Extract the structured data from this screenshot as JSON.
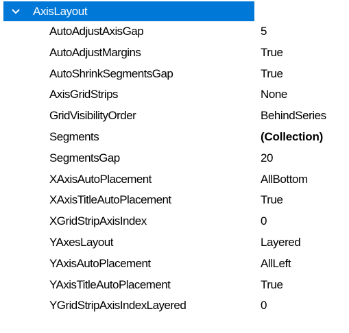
{
  "category": {
    "label": "AxisLayout",
    "expanded": true,
    "icon": "chevron-down-icon",
    "accent": "#0078d7"
  },
  "properties": [
    {
      "name": "AutoAdjustAxisGap",
      "value": "5"
    },
    {
      "name": "AutoAdjustMargins",
      "value": "True"
    },
    {
      "name": "AutoShrinkSegmentsGap",
      "value": "True"
    },
    {
      "name": "AxisGridStrips",
      "value": "None"
    },
    {
      "name": "GridVisibilityOrder",
      "value": "BehindSeries"
    },
    {
      "name": "Segments",
      "value": "(Collection)",
      "bold": true
    },
    {
      "name": "SegmentsGap",
      "value": "20"
    },
    {
      "name": "XAxisAutoPlacement",
      "value": "AllBottom"
    },
    {
      "name": "XAxisTitleAutoPlacement",
      "value": "True"
    },
    {
      "name": "XGridStripAxisIndex",
      "value": "0"
    },
    {
      "name": "YAxesLayout",
      "value": "Layered"
    },
    {
      "name": "YAxisAutoPlacement",
      "value": "AllLeft"
    },
    {
      "name": "YAxisTitleAutoPlacement",
      "value": "True"
    },
    {
      "name": "YGridStripAxisIndexLayered",
      "value": "0"
    }
  ]
}
